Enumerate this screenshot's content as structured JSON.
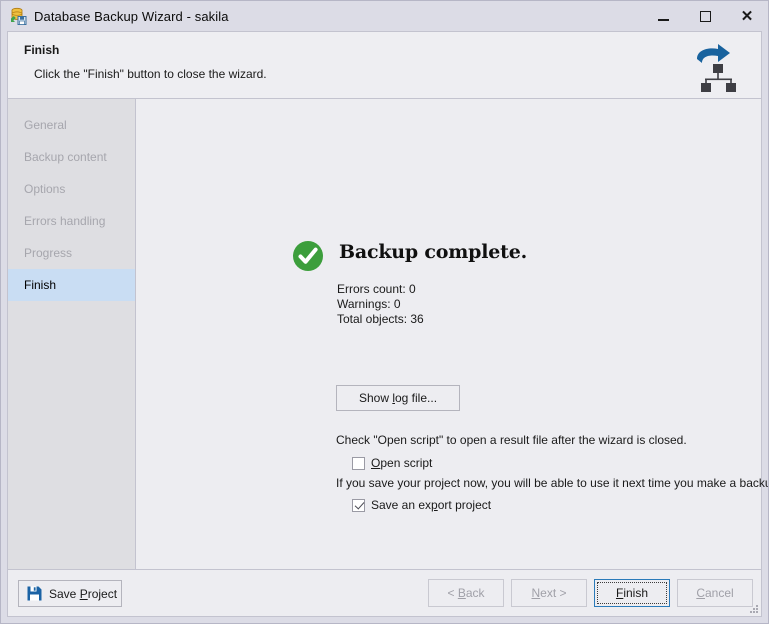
{
  "window": {
    "title": "Database Backup Wizard - sakila",
    "icon": "database-backup-icon",
    "controls": {
      "minimize": "minimize-icon",
      "maximize": "maximize-icon",
      "close": "close-icon"
    }
  },
  "header": {
    "title": "Finish",
    "subtitle": "Click the \"Finish\" button to close the wizard.",
    "logo": "share-network-icon"
  },
  "sidebar": {
    "items": [
      {
        "label": "General",
        "active": false
      },
      {
        "label": "Backup content",
        "active": false
      },
      {
        "label": "Options",
        "active": false
      },
      {
        "label": "Errors handling",
        "active": false
      },
      {
        "label": "Progress",
        "active": false
      },
      {
        "label": "Finish",
        "active": true
      }
    ]
  },
  "main": {
    "status_icon": "success-check-icon",
    "status_title": "Backup complete.",
    "stats": [
      "Errors count: 0",
      "Warnings: 0",
      "Total objects: 36"
    ],
    "show_log_button": "Show log file...",
    "open_script_hint": "Check \"Open script\" to open a result file after the wizard is closed.",
    "open_script_checkbox": {
      "label": "Open script",
      "checked": false
    },
    "save_project_hint": "If you save your project now, you will be able to use it next time you make a backup.",
    "save_export_checkbox": {
      "label": "Save an export project",
      "checked": true
    }
  },
  "footer": {
    "save_project_button": "Save Project",
    "save_project_icon": "floppy-disk-icon",
    "back_button": "< Back",
    "next_button": "Next >",
    "finish_button": "Finish",
    "cancel_button": "Cancel",
    "back_enabled": false,
    "next_enabled": false,
    "finish_enabled": true,
    "cancel_enabled": false
  },
  "colors": {
    "titlebar_bg": "#dcdce6",
    "panel_bg": "#ededf1",
    "header_bg": "#eeeef2",
    "sidebar_bg": "#dedee2",
    "sidebar_selected": "#c9ddf3",
    "sidebar_disabled_text": "#a6a6ad",
    "success_green": "#3c9e3c",
    "accent_blue": "#1f6cb0",
    "default_button_border": "#2a7ab9"
  }
}
